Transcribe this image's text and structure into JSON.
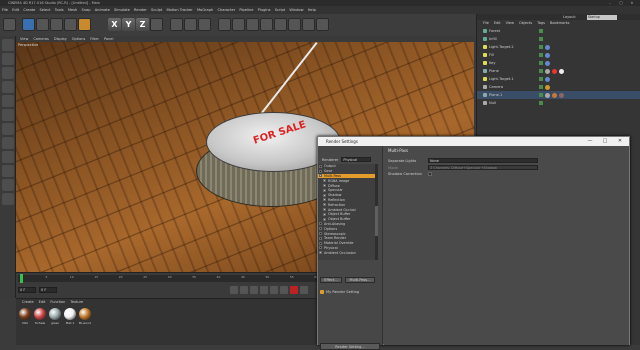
{
  "titlebar": {
    "title": "CINEMA 4D R17.016 Studio (RC-R) - [Untitled] - Main",
    "min": "–",
    "max": "□",
    "close": "✕"
  },
  "menubar": {
    "items": [
      "File",
      "Edit",
      "Create",
      "Select",
      "Tools",
      "Mesh",
      "Snap",
      "Animate",
      "Simulate",
      "Render",
      "Sculpt",
      "Motion Tracker",
      "MoGraph",
      "Character",
      "Pipeline",
      "Plugins",
      "Script",
      "Window",
      "Help"
    ]
  },
  "toolbar": {
    "axis_x": "X",
    "axis_y": "Y",
    "axis_z": "Z"
  },
  "viewport": {
    "menu": [
      "View",
      "Cameras",
      "Display",
      "Options",
      "Filter",
      "Panel"
    ],
    "camera_label": "Perspective",
    "sign_text": "FOR SALE"
  },
  "timeline": {
    "ticks": [
      "0",
      "5",
      "10",
      "15",
      "20",
      "25",
      "30",
      "35",
      "40",
      "45",
      "50",
      "55",
      "60",
      "65",
      "70",
      "75",
      "80",
      "85",
      "90"
    ],
    "start_frame": "0 F",
    "current_frame": "0 F",
    "end_frame": "90 F",
    "max_frame": "90 F"
  },
  "materials": {
    "menu": [
      "Create",
      "Edit",
      "Function",
      "Texture"
    ],
    "items": [
      {
        "name": "Mat",
        "color": "#7a3d1c"
      },
      {
        "name": "forSale",
        "color": "#c44"
      },
      {
        "name": "glass",
        "color": "#9aa"
      },
      {
        "name": "Mat.1",
        "color": "#f2f2f2"
      },
      {
        "name": "Bl-wood",
        "color": "#c07828"
      }
    ]
  },
  "objects_panel": {
    "layout_label": "Layout:",
    "layout_value": "Startup",
    "menu": [
      "File",
      "Edit",
      "View",
      "Objects",
      "Tags",
      "Bookmarks"
    ],
    "rows": [
      {
        "name": "Forest",
        "icon_color": "#6a9",
        "tags": []
      },
      {
        "name": "Infill",
        "icon_color": "#6a9",
        "tags": []
      },
      {
        "name": "Light.Target.2",
        "icon_color": "#dd5",
        "tags": [
          "#68c"
        ]
      },
      {
        "name": "Fill",
        "icon_color": "#dd5",
        "tags": [
          "#68c"
        ]
      },
      {
        "name": "Key",
        "icon_color": "#dd5",
        "tags": [
          "#68c"
        ]
      },
      {
        "name": "Plane",
        "icon_color": "#8aa",
        "tags": [
          "#aaa",
          "#e33",
          "#eee"
        ]
      },
      {
        "name": "Light.Target.1",
        "icon_color": "#dd5",
        "tags": [
          "#68c"
        ]
      },
      {
        "name": "Camera",
        "icon_color": "#aaa",
        "tags": [
          "#c93"
        ]
      },
      {
        "name": "Plane.1",
        "icon_color": "#8aa",
        "tags": [
          "#aaa",
          "#c73",
          "#866"
        ]
      },
      {
        "name": "Null",
        "icon_color": "#aaa",
        "tags": []
      }
    ]
  },
  "render_settings": {
    "title": "Render Settings",
    "min": "—",
    "max": "□",
    "close": "✕",
    "renderer_label": "Renderer",
    "renderer_value": "Physical",
    "list": [
      {
        "label": "Output",
        "level": 0,
        "checked": false,
        "selected": false
      },
      {
        "label": "Save",
        "level": 0,
        "checked": false,
        "selected": false
      },
      {
        "label": "Multi-Pass",
        "level": 0,
        "checked": true,
        "selected": true
      },
      {
        "label": "RGBA Image",
        "level": 1,
        "checked": true,
        "selected": false
      },
      {
        "label": "Diffuse",
        "level": 1,
        "checked": true,
        "selected": false
      },
      {
        "label": "Specular",
        "level": 1,
        "checked": true,
        "selected": false
      },
      {
        "label": "Shadow",
        "level": 1,
        "checked": true,
        "selected": false
      },
      {
        "label": "Reflection",
        "level": 1,
        "checked": true,
        "selected": false
      },
      {
        "label": "Refraction",
        "level": 1,
        "checked": true,
        "selected": false
      },
      {
        "label": "Ambient Occlusi",
        "level": 1,
        "checked": true,
        "selected": false
      },
      {
        "label": "Object Buffer",
        "level": 1,
        "checked": true,
        "selected": false
      },
      {
        "label": "Object Buffer",
        "level": 1,
        "checked": true,
        "selected": false
      },
      {
        "label": "Anti-Aliasing",
        "level": 0,
        "checked": false,
        "selected": false
      },
      {
        "label": "Options",
        "level": 0,
        "checked": false,
        "selected": false
      },
      {
        "label": "Stereoscopic",
        "level": 0,
        "checked": false,
        "selected": false
      },
      {
        "label": "Team Render",
        "level": 0,
        "checked": false,
        "selected": false
      },
      {
        "label": "Material Override",
        "level": 0,
        "checked": false,
        "selected": false
      },
      {
        "label": "Physical",
        "level": 0,
        "checked": false,
        "selected": false
      },
      {
        "label": "Ambient Occlusion",
        "level": 0,
        "checked": true,
        "selected": false
      }
    ],
    "effect_button": "Effect...",
    "multipass_button": "Multi-Pass...",
    "preset_name": "My Render Setting",
    "bottom_button": "Render Setting...",
    "section_header": "Multi-Pass",
    "props": [
      {
        "label": "Separate Lights",
        "value": "None",
        "disabled": false
      },
      {
        "label": "Mode",
        "value": "3 Channels: Diffuse+Specular+Shadow",
        "disabled": true
      },
      {
        "label": "Shadow Correction",
        "value": "",
        "disabled": false
      }
    ]
  }
}
